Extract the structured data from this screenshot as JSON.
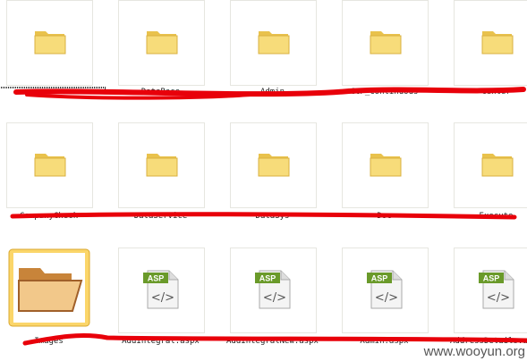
{
  "rows": [
    {
      "items": [
        {
          "type": "folder",
          "label": ""
        },
        {
          "type": "folder",
          "label": "DataBase"
        },
        {
          "type": "folder",
          "label": "Admin"
        },
        {
          "type": "folder",
          "label": "CCP_Continuous"
        },
        {
          "type": "folder",
          "label": "Center"
        }
      ]
    },
    {
      "items": [
        {
          "type": "folder",
          "label": "CompanyCheck"
        },
        {
          "type": "folder",
          "label": "DataService"
        },
        {
          "type": "folder",
          "label": "DataSys"
        },
        {
          "type": "folder",
          "label": "Doc"
        },
        {
          "type": "folder",
          "label": "Execute"
        }
      ]
    },
    {
      "items": [
        {
          "type": "folder-open",
          "label": "Images"
        },
        {
          "type": "asp",
          "label": "AddIntegral.aspx",
          "badge": "ASP"
        },
        {
          "type": "asp",
          "label": "AddIntegralNew.aspx",
          "badge": "ASP"
        },
        {
          "type": "asp",
          "label": "Admin.aspx",
          "badge": "ASP"
        },
        {
          "type": "asp",
          "label": "AddressDetails.aspx",
          "badge": "ASP"
        }
      ]
    }
  ],
  "watermark": "www.wooyun.org",
  "colors": {
    "ink": "#e8000a",
    "asp_badge": "#6a9a2a",
    "folder": "#f5d76a"
  }
}
